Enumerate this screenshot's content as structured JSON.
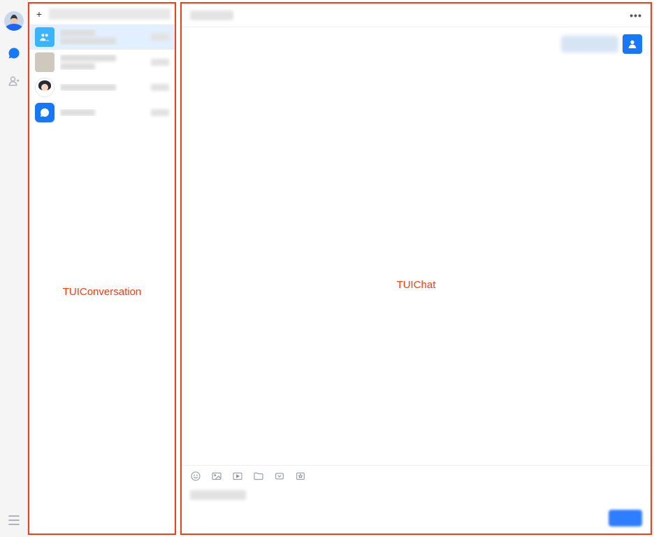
{
  "nav": {
    "items": [
      "message",
      "contacts"
    ],
    "active": "message"
  },
  "conversation_panel": {
    "annotation": "TUIConversation",
    "items": [
      {
        "avatar_type": "group",
        "selected": true
      },
      {
        "avatar_type": "photo",
        "selected": false
      },
      {
        "avatar_type": "girl",
        "selected": false
      },
      {
        "avatar_type": "bot",
        "selected": false
      }
    ]
  },
  "chat_panel": {
    "annotation": "TUIChat",
    "header": {
      "more": "•••"
    },
    "toolbar_icons": [
      "emoji-icon",
      "image-icon",
      "video-icon",
      "folder-icon",
      "capture-icon",
      "star-icon"
    ]
  }
}
